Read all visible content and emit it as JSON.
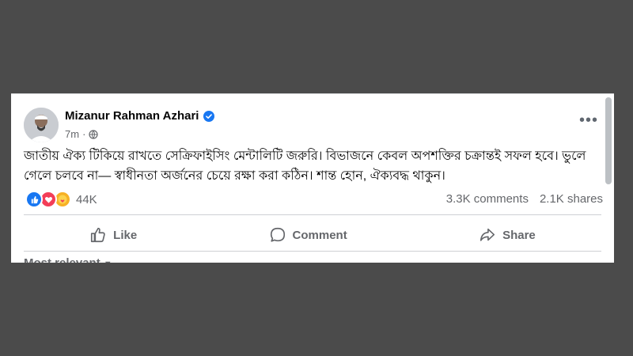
{
  "post": {
    "author": "Mizanur Rahman Azhari",
    "time": "7m",
    "text": "জাতীয় ঐক্য টিকিয়ে রাখতে সেক্রিফাইসিং মেন্টালিটি জরুরি। বিভাজনে কেবল অপশক্তির চক্রান্তই সফল হবে। ভুলে গেলে চলবে না— স্বাধীনতা অর্জনের চেয়ে রক্ষা করা কঠিন। শান্ত হোন, ঐক্যবদ্ধ থাকুন।",
    "reactions_count": "44K",
    "comments": "3.3K comments",
    "shares": "2.1K shares",
    "more_glyph": "•••"
  },
  "actions": {
    "like": "Like",
    "comment": "Comment",
    "share": "Share"
  },
  "comments_filter": "Most relevant",
  "icons": {
    "verified": "verified-badge-icon",
    "privacy": "globe-icon",
    "reactions": [
      "like-reaction-icon",
      "love-reaction-icon",
      "care-reaction-icon"
    ]
  },
  "colors": {
    "accent": "#1877f2",
    "text": "#050505",
    "secondary": "#65676b",
    "background": "#4b4b4b"
  }
}
